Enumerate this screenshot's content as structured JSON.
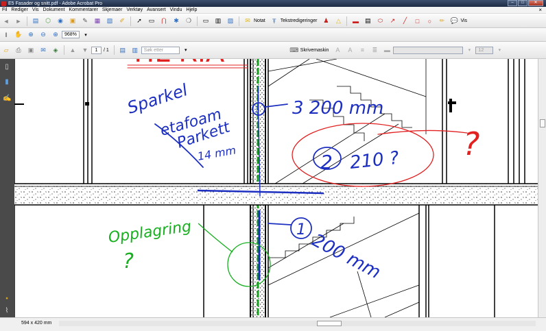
{
  "window": {
    "title": "E5 Fasader og snitt.pdf - Adobe Acrobat Pro"
  },
  "menu": {
    "items": [
      "Fil",
      "Rediger",
      "Vis",
      "Dokument",
      "Kommentarer",
      "Skjemaer",
      "Verktøy",
      "Avansert",
      "Vindu",
      "Hjelp"
    ]
  },
  "toolbar": {
    "notes_label": "Notat",
    "text_edits_label": "Tekstredigeringer",
    "view_label": "Vis",
    "zoom_value": "968%",
    "page_current": "1",
    "page_total": "/ 1",
    "search_placeholder": "Søk etter",
    "typewriter_label": "Skrivemaskin",
    "font_size_value": "12"
  },
  "status": {
    "page_size": "594 x 420 mm"
  },
  "annotations": {
    "header_red": "TIL RIA",
    "floor_note": [
      "Sparkel",
      "etafoam",
      "Parkett",
      "14 mm"
    ],
    "dim_top": "3 200 mm",
    "circle_marker_top": "3",
    "circle_marker_2": "2",
    "dim_2": "210 ?",
    "question_red": "?",
    "circle_marker_1": "1",
    "dim_bottom": "200 mm",
    "storage_note": [
      "Opplagring",
      "?"
    ]
  },
  "colors": {
    "ink_red": "#e22020",
    "ink_blue": "#1d2fc0",
    "ink_green": "#18b020",
    "acrobat_red": "#c8201e"
  }
}
